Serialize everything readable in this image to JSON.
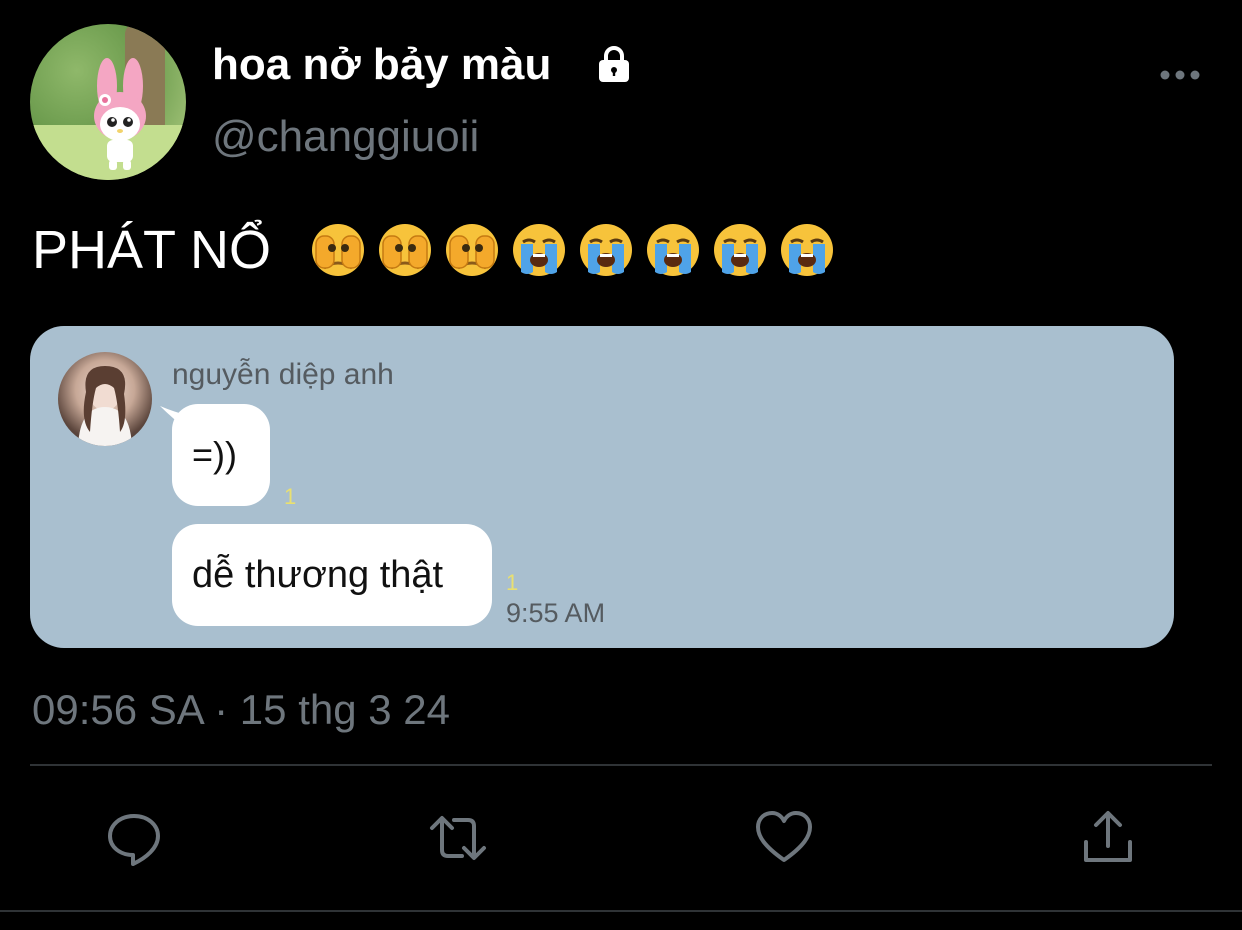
{
  "profile": {
    "display_name": "hoa nở bảy màu",
    "handle": "@changgiuoii",
    "avatar": "my-melody-avatar",
    "protected_icon": "lock-icon",
    "menu_icon": "more-horizontal-icon"
  },
  "tweet": {
    "text": "PHÁT NỔ",
    "emojis": [
      "face-covering-eyes",
      "face-covering-eyes",
      "face-covering-eyes",
      "loudly-crying-face",
      "loudly-crying-face",
      "loudly-crying-face",
      "loudly-crying-face",
      "loudly-crying-face"
    ],
    "timestamp": "09:56 SA · 15 thg 3 24"
  },
  "media": {
    "background_color": "#a9bfcf",
    "chat": {
      "sender": "nguyễn diệp anh",
      "messages": [
        {
          "text": "=))",
          "read_count": "1"
        },
        {
          "text": "dễ thương thật",
          "read_count": "1",
          "time": "9:55 AM"
        }
      ]
    }
  },
  "actions": [
    {
      "name": "reply",
      "icon": "reply-icon"
    },
    {
      "name": "retweet",
      "icon": "retweet-icon"
    },
    {
      "name": "like",
      "icon": "heart-icon"
    },
    {
      "name": "share",
      "icon": "share-icon"
    }
  ],
  "colors": {
    "background": "#000000",
    "secondary_text": "#6e767d",
    "divider": "#2f3336",
    "read_count": "#e9e070"
  }
}
